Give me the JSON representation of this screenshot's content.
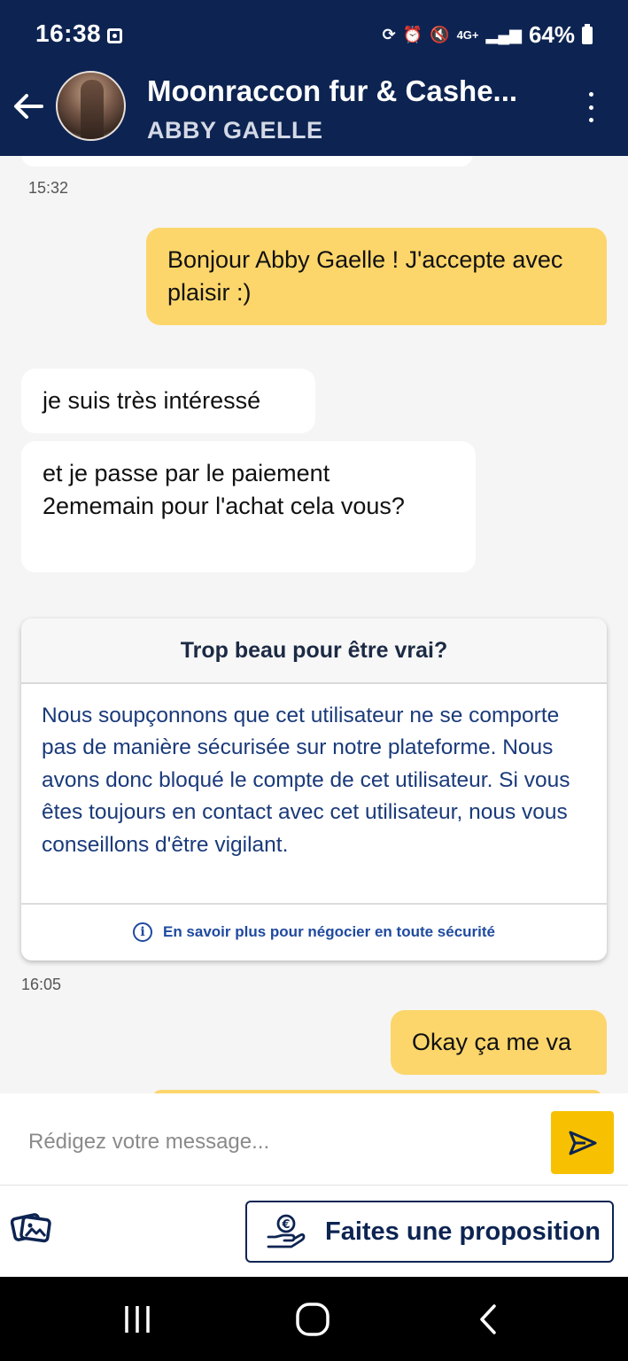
{
  "status_bar": {
    "time": "16:38",
    "network": "4G+",
    "battery": "64%"
  },
  "header": {
    "title": "Moonraccon fur & Cashe...",
    "subtitle": "ABBY GAELLE"
  },
  "messages": [
    {
      "type": "timestamp",
      "text": "15:32"
    },
    {
      "type": "outgoing",
      "text": "Bonjour Abby Gaelle ! J'accepte avec plaisir :)"
    },
    {
      "type": "incoming",
      "text": "je suis très intéressé"
    },
    {
      "type": "incoming",
      "text": "et je passe par le paiement 2ememain pour l'achat cela vous?"
    },
    {
      "type": "timestamp",
      "text": "16:05"
    },
    {
      "type": "outgoing",
      "text": "Okay ça me va"
    }
  ],
  "warning": {
    "title": "Trop beau pour être vrai?",
    "body": "Nous soupçonnons que cet utilisateur ne se comporte pas de manière sécurisée sur notre plateforme. Nous avons donc bloqué le compte de cet utilisateur. Si vous êtes toujours en contact avec cet utilisateur, nous vous conseillons d'être vigilant.",
    "link": "En savoir plus pour négocier en toute sécurité"
  },
  "composer": {
    "placeholder": "Rédigez votre message..."
  },
  "actions": {
    "offer_label": "Faites une proposition"
  },
  "colors": {
    "header_bg": "#0d2452",
    "outgoing_bubble": "#fcd66b",
    "send_button": "#f7c000",
    "link_blue": "#1f4aa0"
  },
  "icons": [
    "back-arrow-icon",
    "more-vert-icon",
    "send-icon",
    "image-gallery-icon",
    "hand-euro-icon",
    "info-icon"
  ]
}
